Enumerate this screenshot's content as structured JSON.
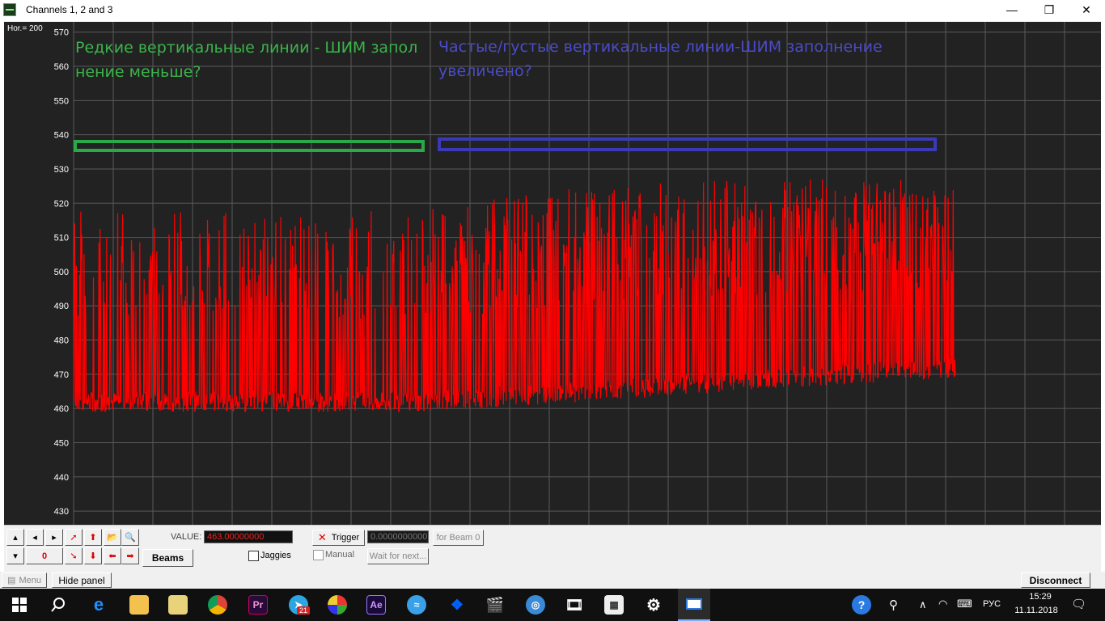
{
  "window": {
    "title": "Channels 1, 2 and 3",
    "minimize": "—",
    "maximize": "❐",
    "close": "✕"
  },
  "plot": {
    "hor_label": "Hor.= 200",
    "y_ticks": [
      "570",
      "560",
      "550",
      "540",
      "530",
      "520",
      "510",
      "500",
      "490",
      "480",
      "470",
      "460",
      "450",
      "440",
      "430"
    ],
    "note_left": [
      "Редкие вертикальные линии - ШИМ запол",
      "нение меньше?"
    ],
    "note_right": [
      "Частые/густые вертикальные линии-ШИМ заполнение",
      "увеличено?"
    ],
    "colors": {
      "background": "#222222",
      "grid": "#5a5a5a",
      "signal": "#ff0000",
      "green_box": "#2aa84a",
      "blue_box": "#3a3ab8",
      "note_green": "#3ab54a",
      "note_blue": "#4b4bc8"
    }
  },
  "chart_data": {
    "type": "line",
    "title": "",
    "xlabel": "",
    "ylabel": "",
    "ylim": [
      426,
      573
    ],
    "grid": true,
    "series": [
      {
        "values": [
          460,
          518,
          462,
          517,
          460,
          519,
          461,
          520,
          462,
          528,
          463,
          529,
          464,
          527,
          465,
          526
        ]
      }
    ]
  },
  "panel": {
    "value_label": "VALUE:",
    "value": "463.00000000",
    "counter": "0",
    "beams_label": "Beams",
    "jaggies_label": "Jaggies",
    "trigger_label": "Trigger",
    "trigger_value": "0.0000000000",
    "for_beam_label": "for Beam 0",
    "manual_label": "Manual",
    "wait_label": "Wait for next..."
  },
  "bottom": {
    "menu_label": "Menu",
    "hide_panel_label": "Hide panel",
    "disconnect_label": "Disconnect"
  },
  "taskbar": {
    "lang": "РУС",
    "time": "15:29",
    "date": "11.11.2018",
    "badge": "21",
    "apps": [
      "windows-start",
      "search",
      "edge",
      "file-explorer",
      "notes",
      "chrome",
      "premiere",
      "telegram",
      "pinwheel",
      "after-effects",
      "xcloud",
      "dropbox",
      "video-editor",
      "browser-globe",
      "film-reel",
      "calculator",
      "settings",
      "active-app"
    ]
  }
}
